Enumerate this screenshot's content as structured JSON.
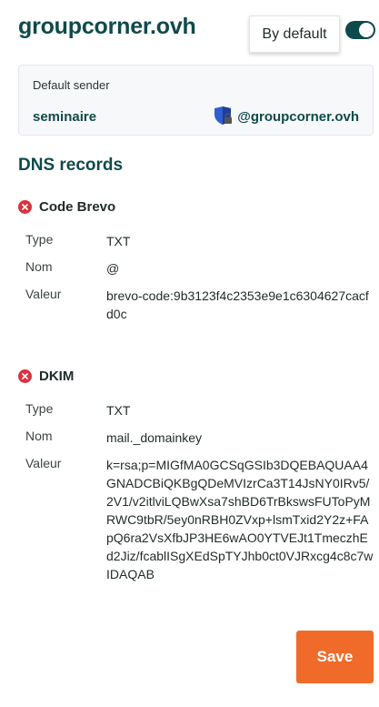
{
  "header": {
    "domain": "groupcorner.ovh",
    "default_button": "By default",
    "toggle_on": true
  },
  "sender": {
    "label": "Default sender",
    "name": "seminaire",
    "domain": "@groupcorner.ovh",
    "icon": "shield-lock-icon"
  },
  "dns": {
    "title": "DNS records",
    "records": [
      {
        "title": "Code Brevo",
        "status": "error",
        "fields": [
          {
            "label": "Type",
            "value": "TXT"
          },
          {
            "label": "Nom",
            "value": "@"
          },
          {
            "label": "Valeur",
            "value": "brevo-code:9b3123f4c2353e9e1c6304627cacfd0c"
          }
        ]
      },
      {
        "title": "DKIM",
        "status": "error",
        "fields": [
          {
            "label": "Type",
            "value": "TXT"
          },
          {
            "label": "Nom",
            "value": "mail._domainkey"
          },
          {
            "label": "Valeur",
            "value": "k=rsa;p=MIGfMA0GCSqGSIb3DQEBAQUAA4GNADCBiQKBgQDeMVIzrCa3T14JsNY0IRv5/2V1/v2itlviLQBwXsa7shBD6TrBkswsFUToPyMRWC9tbR/5ey0nRBH0ZVxp+lsmTxid2Y2z+FApQ6ra2VsXfbJP3HE6wAO0YTVEJt1TmeczhEd2Jiz/fcablISgXEdSpTYJhb0ct0VJRxcg4c8c7wIDAQAB"
          }
        ]
      }
    ]
  },
  "footer": {
    "save_label": "Save"
  },
  "colors": {
    "brand_teal": "#0f4a4a",
    "error_red": "#d8333f",
    "save_orange": "#f06a2a"
  }
}
